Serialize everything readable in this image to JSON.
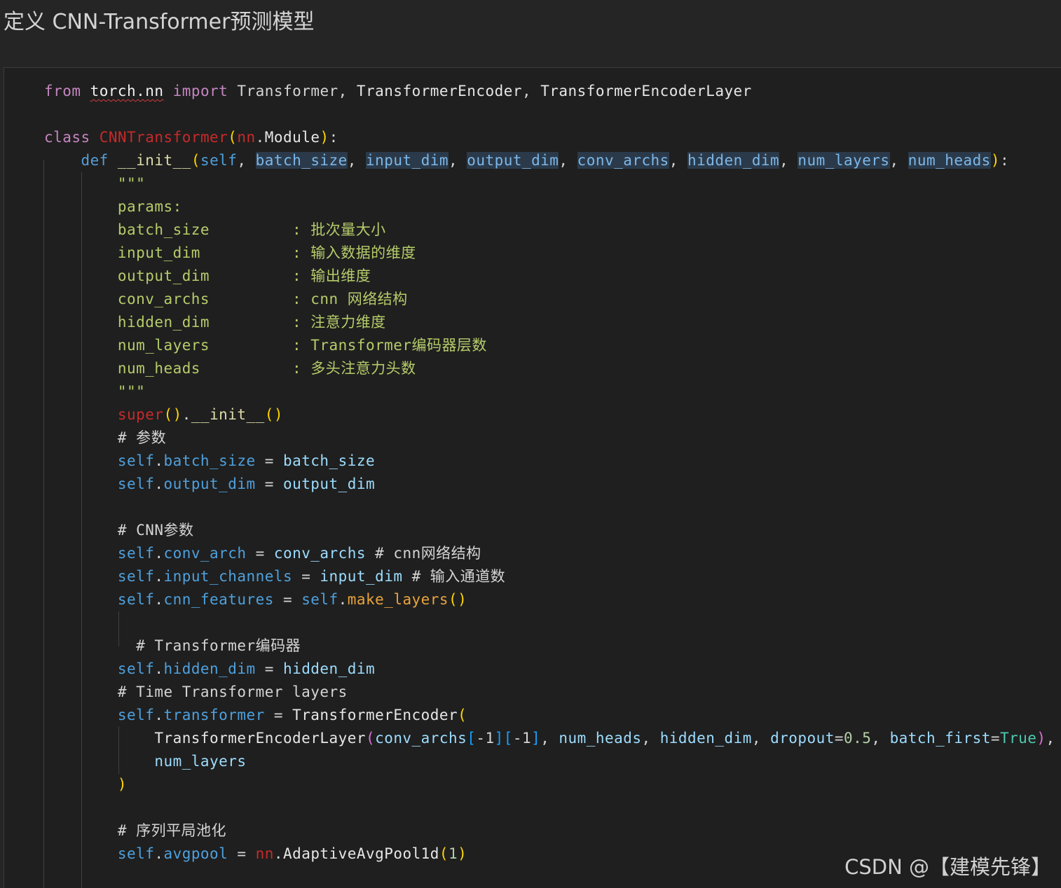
{
  "heading": "定义 CNN-Transformer预测模型",
  "watermark": "CSDN @【建模先锋】",
  "colors": {
    "page_bg": "#252526",
    "code_bg": "#1f1f1f",
    "keyword": "#c586c0",
    "def_keyword": "#569cd6",
    "error_red": "#c72a2a",
    "parameter": "#9cdcfe",
    "self": "#4ea0dd",
    "docstring": "#b5cc6a",
    "call": "#e8a33c",
    "bracket_1": "#ffd700",
    "bracket_2": "#da70d6",
    "bracket_3": "#179fff"
  },
  "code_lines": [
    [
      [
        "kw",
        "from"
      ],
      [
        "op",
        " "
      ],
      [
        "mod",
        "torch.nn"
      ],
      [
        "op",
        " "
      ],
      [
        "kw",
        "import"
      ],
      [
        "op",
        " "
      ],
      [
        "op",
        "Transformer, "
      ],
      [
        "plain",
        "TransformerEncoder"
      ],
      [
        "op",
        ", "
      ],
      [
        "plain",
        "TransformerEncoderLayer"
      ]
    ],
    [],
    [
      [
        "kw",
        "class"
      ],
      [
        "op",
        " "
      ],
      [
        "cls-err",
        "CNNTransformer"
      ],
      [
        "p1",
        "("
      ],
      [
        "cls-err",
        "nn"
      ],
      [
        "op",
        "."
      ],
      [
        "plain",
        "Module"
      ],
      [
        "p1",
        ")"
      ],
      [
        "op",
        ":"
      ]
    ],
    [
      [
        "op",
        "    "
      ],
      [
        "def",
        "def"
      ],
      [
        "op",
        " "
      ],
      [
        "fn",
        "__init__"
      ],
      [
        "p1",
        "("
      ],
      [
        "self",
        "self"
      ],
      [
        "op",
        ", "
      ],
      [
        "prm hl",
        "batch_size"
      ],
      [
        "op",
        ", "
      ],
      [
        "prm hl",
        "input_dim"
      ],
      [
        "op",
        ", "
      ],
      [
        "prm hl",
        "output_dim"
      ],
      [
        "op",
        ", "
      ],
      [
        "prm hl",
        "conv_archs"
      ],
      [
        "op",
        ", "
      ],
      [
        "prm hl",
        "hidden_dim"
      ],
      [
        "op",
        ", "
      ],
      [
        "prm hl",
        "num_layers"
      ],
      [
        "op",
        ", "
      ],
      [
        "prm hl",
        "num_heads"
      ],
      [
        "p1",
        ")"
      ],
      [
        "op",
        ":"
      ]
    ],
    [
      [
        "op",
        "        "
      ],
      [
        "doc",
        "\"\"\""
      ]
    ],
    [
      [
        "op",
        "        "
      ],
      [
        "doc",
        "params:"
      ]
    ],
    [
      [
        "op",
        "        "
      ],
      [
        "doc",
        "batch_size         : 批次量大小"
      ]
    ],
    [
      [
        "op",
        "        "
      ],
      [
        "doc",
        "input_dim          : 输入数据的维度"
      ]
    ],
    [
      [
        "op",
        "        "
      ],
      [
        "doc",
        "output_dim         : 输出维度"
      ]
    ],
    [
      [
        "op",
        "        "
      ],
      [
        "doc",
        "conv_archs         : cnn 网络结构"
      ]
    ],
    [
      [
        "op",
        "        "
      ],
      [
        "doc",
        "hidden_dim         : 注意力维度"
      ]
    ],
    [
      [
        "op",
        "        "
      ],
      [
        "doc",
        "num_layers         : Transformer编码器层数"
      ]
    ],
    [
      [
        "op",
        "        "
      ],
      [
        "doc",
        "num_heads          : 多头注意力头数"
      ]
    ],
    [
      [
        "op",
        "        "
      ],
      [
        "doc",
        "\"\"\""
      ]
    ],
    [
      [
        "op",
        "        "
      ],
      [
        "cls-err",
        "super"
      ],
      [
        "p1",
        "()"
      ],
      [
        "op",
        "."
      ],
      [
        "fn",
        "__init__"
      ],
      [
        "p1",
        "()"
      ]
    ],
    [
      [
        "op",
        "        "
      ],
      [
        "cmt",
        "# 参数"
      ]
    ],
    [
      [
        "op",
        "        "
      ],
      [
        "self",
        "self"
      ],
      [
        "op",
        "."
      ],
      [
        "attr",
        "batch_size"
      ],
      [
        "op",
        " = "
      ],
      [
        "param",
        "batch_size"
      ]
    ],
    [
      [
        "op",
        "        "
      ],
      [
        "self",
        "self"
      ],
      [
        "op",
        "."
      ],
      [
        "attr",
        "output_dim"
      ],
      [
        "op",
        " = "
      ],
      [
        "param",
        "output_dim"
      ]
    ],
    [],
    [
      [
        "op",
        "        "
      ],
      [
        "cmt",
        "# CNN参数"
      ]
    ],
    [
      [
        "op",
        "        "
      ],
      [
        "self",
        "self"
      ],
      [
        "op",
        "."
      ],
      [
        "attr",
        "conv_arch"
      ],
      [
        "op",
        " = "
      ],
      [
        "param",
        "conv_archs"
      ],
      [
        "op",
        " "
      ],
      [
        "cmt",
        "# cnn网络结构"
      ]
    ],
    [
      [
        "op",
        "        "
      ],
      [
        "self",
        "self"
      ],
      [
        "op",
        "."
      ],
      [
        "attr",
        "input_channels"
      ],
      [
        "op",
        " = "
      ],
      [
        "param",
        "input_dim"
      ],
      [
        "op",
        " "
      ],
      [
        "cmt",
        "# 输入通道数"
      ]
    ],
    [
      [
        "op",
        "        "
      ],
      [
        "self",
        "self"
      ],
      [
        "op",
        "."
      ],
      [
        "attr",
        "cnn_features"
      ],
      [
        "op",
        " = "
      ],
      [
        "self",
        "self"
      ],
      [
        "op",
        "."
      ],
      [
        "call",
        "make_layers"
      ],
      [
        "p1",
        "()"
      ]
    ],
    [],
    [
      [
        "op",
        "          "
      ],
      [
        "cmt",
        "# Transformer编码器"
      ]
    ],
    [
      [
        "op",
        "        "
      ],
      [
        "self",
        "self"
      ],
      [
        "op",
        "."
      ],
      [
        "attr",
        "hidden_dim"
      ],
      [
        "op",
        " = "
      ],
      [
        "param",
        "hidden_dim"
      ]
    ],
    [
      [
        "op",
        "        "
      ],
      [
        "cmt",
        "# Time Transformer layers"
      ]
    ],
    [
      [
        "op",
        "        "
      ],
      [
        "self",
        "self"
      ],
      [
        "op",
        "."
      ],
      [
        "attr",
        "transformer"
      ],
      [
        "op",
        " = "
      ],
      [
        "plain",
        "TransformerEncoder"
      ],
      [
        "p1",
        "("
      ]
    ],
    [
      [
        "op",
        "            "
      ],
      [
        "plain",
        "TransformerEncoderLayer"
      ],
      [
        "p2",
        "("
      ],
      [
        "param",
        "conv_archs"
      ],
      [
        "p3",
        "["
      ],
      [
        "op",
        "-1"
      ],
      [
        "p3",
        "]["
      ],
      [
        "op",
        "-1"
      ],
      [
        "p3",
        "]"
      ],
      [
        "op",
        ", "
      ],
      [
        "param",
        "num_heads"
      ],
      [
        "op",
        ", "
      ],
      [
        "param",
        "hidden_dim"
      ],
      [
        "op",
        ", "
      ],
      [
        "param",
        "dropout"
      ],
      [
        "op",
        "="
      ],
      [
        "num",
        "0.5"
      ],
      [
        "op",
        ", "
      ],
      [
        "param",
        "batch_first"
      ],
      [
        "op",
        "="
      ],
      [
        "bool",
        "True"
      ],
      [
        "p2",
        ")"
      ],
      [
        "op",
        ","
      ]
    ],
    [
      [
        "op",
        "            "
      ],
      [
        "param",
        "num_layers"
      ]
    ],
    [
      [
        "op",
        "        "
      ],
      [
        "p1",
        ")"
      ]
    ],
    [],
    [
      [
        "op",
        "        "
      ],
      [
        "cmt",
        "# 序列平局池化"
      ]
    ],
    [
      [
        "op",
        "        "
      ],
      [
        "self",
        "self"
      ],
      [
        "op",
        "."
      ],
      [
        "attr",
        "avgpool"
      ],
      [
        "op",
        " = "
      ],
      [
        "cls-err",
        "nn"
      ],
      [
        "op",
        "."
      ],
      [
        "plain",
        "AdaptiveAvgPool1d"
      ],
      [
        "p1",
        "("
      ],
      [
        "num",
        "1"
      ],
      [
        "p1",
        ")"
      ]
    ]
  ]
}
